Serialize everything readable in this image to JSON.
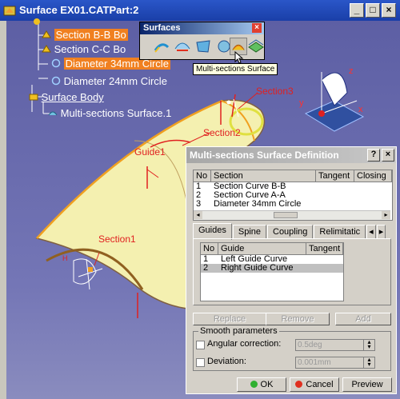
{
  "window": {
    "title": "Surface EX01.CATPart:2",
    "controls": {
      "minimize": "_",
      "maximize": "□",
      "close": "×"
    }
  },
  "tree": {
    "items": [
      {
        "label": "Section B-B Bo",
        "highlighted": true
      },
      {
        "label": "Section C-C Bo",
        "highlighted": false
      },
      {
        "label": "Diameter 34mm Circle",
        "highlighted": true
      },
      {
        "label": "Diameter 24mm Circle",
        "highlighted": false
      },
      {
        "label": "Surface Body",
        "highlighted": false,
        "underline": true
      },
      {
        "label": "Multi-sections Surface.1",
        "highlighted": false
      }
    ]
  },
  "surfaces_toolbar": {
    "title": "Surfaces",
    "close": "×",
    "tooltip": "Multi-sections Surface"
  },
  "viewport_labels": {
    "section1": "Section1",
    "section2": "Section2",
    "section3": "Section3",
    "guide1": "Guide1",
    "axis_x": "x",
    "axis_y": "y",
    "axis_z": "z"
  },
  "dialog": {
    "title": "Multi-sections Surface Definition",
    "help": "?",
    "close": "×",
    "sections_table": {
      "headers": [
        "No",
        "Section",
        "Tangent",
        "Closing"
      ],
      "rows": [
        {
          "no": "1",
          "section": "Section Curve B-B"
        },
        {
          "no": "2",
          "section": "Section Curve A-A"
        },
        {
          "no": "3",
          "section": "Diameter 34mm Circle"
        }
      ]
    },
    "tabs": [
      "Guides",
      "Spine",
      "Coupling",
      "Relimitatic"
    ],
    "guides_table": {
      "headers": [
        "No",
        "Guide",
        "Tangent"
      ],
      "rows": [
        {
          "no": "1",
          "guide": "Left Guide Curve",
          "selected": false
        },
        {
          "no": "2",
          "guide": "Right Guide Curve",
          "selected": true
        }
      ]
    },
    "list_buttons": {
      "replace": "Replace",
      "remove": "Remove",
      "add": "Add"
    },
    "smooth": {
      "legend": "Smooth parameters",
      "angular_label": "Angular correction:",
      "angular_value": "0.5deg",
      "deviation_label": "Deviation:",
      "deviation_value": "0.001mm"
    },
    "buttons": {
      "ok": "OK",
      "cancel": "Cancel",
      "preview": "Preview"
    }
  },
  "colors": {
    "highlight": "#f08020",
    "title_blue": "#1a3fa8",
    "surface": "#f4f0b0",
    "annotation_red": "#e02020"
  }
}
